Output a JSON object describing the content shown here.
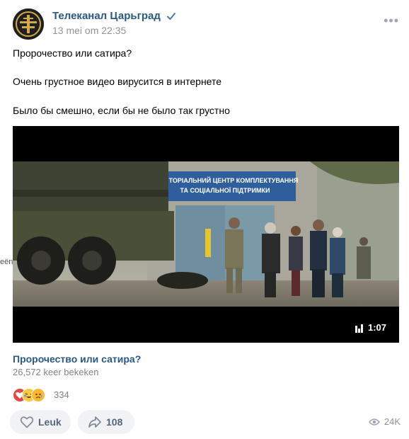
{
  "post": {
    "author": "Телеканал Царьград",
    "date": "13 mei om 22:35",
    "text_lines": [
      "Пророчество или сатира?",
      "Очень грустное видео вирусится в интернете",
      "Было бы смешно, если бы не было так грустно"
    ]
  },
  "video": {
    "duration": "1:07",
    "sign_line1": "ТЕРИТОРІАЛЬНИЙ ЦЕНТР КОМПЛЕКТУВАННЯ",
    "sign_line2": "ТА СОЦІАЛЬНОЇ ПІДТРИМКИ",
    "title": "Пророчество или сатира?",
    "views": "26,572 keer bekeken"
  },
  "side_label": "eën",
  "reactions": {
    "count": "334",
    "emoji": [
      "heart-icon",
      "laughing-icon",
      "sad-icon"
    ],
    "colors": {
      "heart": "#e64646",
      "laugh": "#ffc83d",
      "sad": "#ffb830"
    }
  },
  "actions": {
    "like_label": "Leuk",
    "share_count": "108",
    "view_count": "24K"
  },
  "colors": {
    "link": "#2a5885",
    "muted": "#939393",
    "button_bg": "#f0f2f5",
    "verified": "#4a76a8"
  }
}
